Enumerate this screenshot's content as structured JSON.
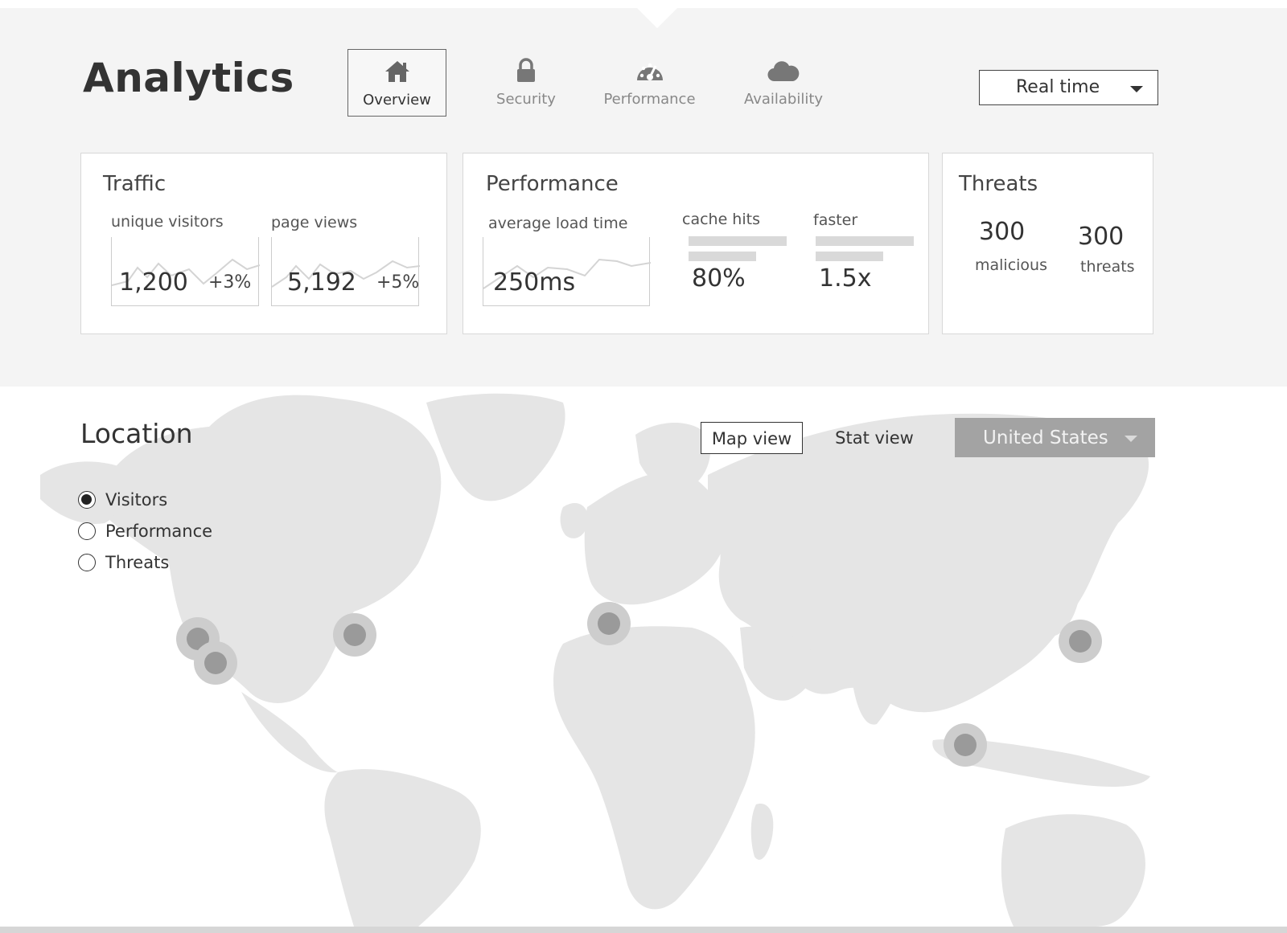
{
  "header": {
    "title": "Analytics",
    "tabs": [
      {
        "label": "Overview",
        "icon": "home-icon",
        "active": true
      },
      {
        "label": "Security",
        "icon": "lock-icon",
        "active": false
      },
      {
        "label": "Performance",
        "icon": "speedometer-icon",
        "active": false
      },
      {
        "label": "Availability",
        "icon": "cloud-icon",
        "active": false
      }
    ],
    "time_range": "Real time"
  },
  "cards": {
    "traffic": {
      "title": "Traffic",
      "unique_visitors": {
        "label": "unique visitors",
        "value": "1,200",
        "change": "+3%"
      },
      "page_views": {
        "label": "page views",
        "value": "5,192",
        "change": "+5%"
      }
    },
    "performance": {
      "title": "Performance",
      "load_time": {
        "label": "average load time",
        "value": "250ms"
      },
      "cache_hits": {
        "label": "cache hits",
        "value": "80%"
      },
      "faster": {
        "label": "faster",
        "value": "1.5x"
      }
    },
    "threats": {
      "title": "Threats",
      "malicious": {
        "value": "300",
        "label": "malicious"
      },
      "threats": {
        "value": "300",
        "label": "threats"
      }
    }
  },
  "location": {
    "title": "Location",
    "radios": [
      {
        "label": "Visitors",
        "checked": true
      },
      {
        "label": "Performance",
        "checked": false
      },
      {
        "label": "Threats",
        "checked": false
      }
    ],
    "view_toggle": {
      "map": "Map view",
      "stat": "Stat view",
      "active": "map"
    },
    "country": "United States"
  },
  "colors": {
    "header_bg": "#f4f4f4",
    "land": "#e5e5e5",
    "marker": "#9a9a9a",
    "marker_halo": "#cdcdcd",
    "country_select_bg": "#a3a3a3"
  }
}
